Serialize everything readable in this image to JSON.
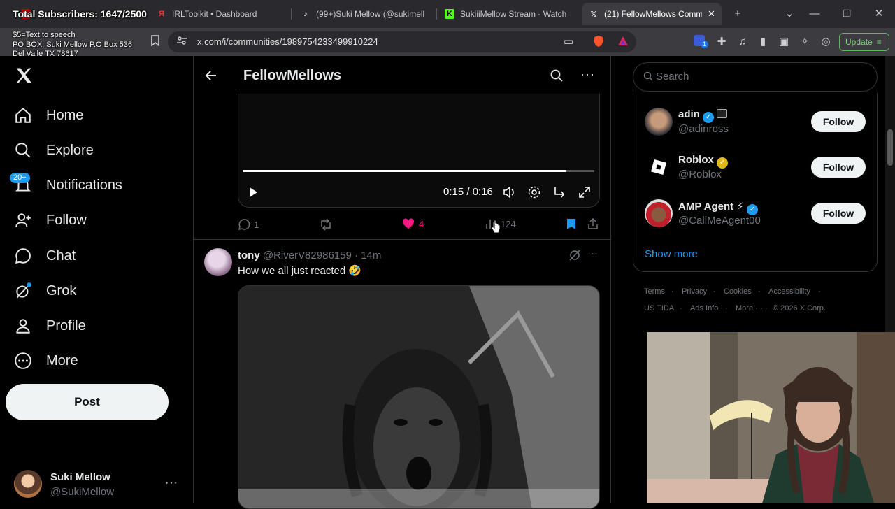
{
  "browser": {
    "tabs": [
      {
        "label": "(99+)Suki Mellow (@sukimell",
        "icon": "tiktok-icon"
      },
      {
        "label": "IRLToolkit • Dashboard",
        "icon": "irltoolkit-icon"
      },
      {
        "label": "SukiiiMellow Stream - Watch",
        "icon": "kick-icon"
      },
      {
        "label": "(21) FellowMellows Comm",
        "icon": "x-icon"
      }
    ],
    "url": "x.com/i/communities/1989754233499910224",
    "update_label": "Update",
    "extension_badge": "1"
  },
  "overlay": {
    "subs": "Total Subscribers: 1647/2500",
    "tts": "$5=Text to speech",
    "po_box_1": "PO BOX: Suki Mellow P.O Box 536",
    "po_box_2": "Del Valle TX 78617"
  },
  "nav": {
    "items": [
      {
        "label": "Home",
        "icon": "home-icon"
      },
      {
        "label": "Explore",
        "icon": "search-icon"
      },
      {
        "label": "Notifications",
        "icon": "bell-icon"
      },
      {
        "label": "Follow",
        "icon": "follow-icon"
      },
      {
        "label": "Chat",
        "icon": "chat-icon"
      },
      {
        "label": "Grok",
        "icon": "grok-icon"
      },
      {
        "label": "Profile",
        "icon": "profile-icon"
      },
      {
        "label": "More",
        "icon": "more-circle-icon"
      }
    ],
    "notif_badge": "20+",
    "post_label": "Post",
    "user_name": "Suki Mellow",
    "user_handle": "@SukiMellow"
  },
  "header": {
    "title": "FellowMellows"
  },
  "video": {
    "time": "0:15 / 0:16",
    "progress": 0.92
  },
  "tweet1_actions": {
    "replies": "1",
    "likes": "4",
    "views": "124"
  },
  "tweet2": {
    "name": "tony",
    "handle": "@RiverV82986159",
    "time": "· 14m",
    "text": "How we all just reacted 🤣"
  },
  "right": {
    "search_placeholder": "Search",
    "accounts": [
      {
        "name": "adin",
        "handle": "@adinross",
        "follow": "Follow"
      },
      {
        "name": "Roblox",
        "handle": "@Roblox",
        "follow": "Follow"
      },
      {
        "name": "AMP Agent ⚡",
        "handle": "@CallMeAgent00",
        "follow": "Follow"
      }
    ],
    "show_more": "Show more",
    "footer": {
      "terms": "Terms",
      "privacy": "Privacy",
      "cookies": "Cookies",
      "accessibility": "Accessibility",
      "us_tida": "US TIDA",
      "ads_info": "Ads Info",
      "more": "More ···",
      "copyright": "© 2026 X Corp."
    }
  },
  "colors": {
    "accent": "#1d9bf0",
    "like": "#f91880",
    "background": "#000000"
  }
}
